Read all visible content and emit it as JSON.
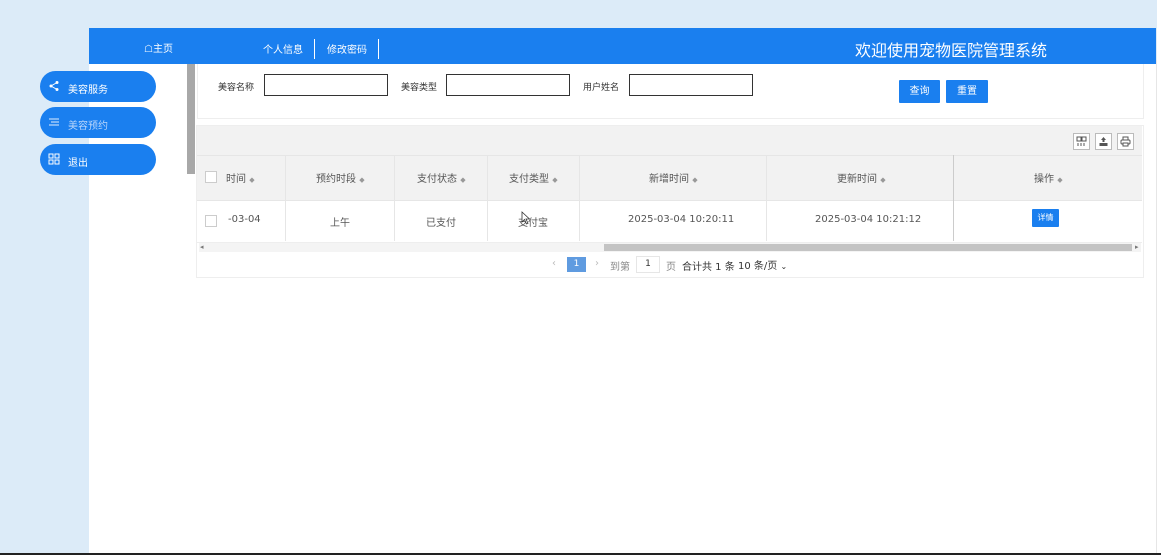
{
  "colors": {
    "primary": "#1a7fef",
    "page_bg": "#dcebf8"
  },
  "header": {
    "home_label": "☖主页",
    "nav": [
      "个人信息",
      "修改密码"
    ],
    "title": "欢迎使用宠物医院管理系统"
  },
  "sidebar": {
    "items": [
      {
        "icon": "share-icon",
        "label": "美容服务"
      },
      {
        "icon": "list-icon",
        "label": "美容预约"
      },
      {
        "icon": "grid-icon",
        "label": "退出"
      }
    ]
  },
  "search": {
    "fields": [
      {
        "label": "美容名称",
        "value": ""
      },
      {
        "label": "美容类型",
        "value": ""
      },
      {
        "label": "用户姓名",
        "value": ""
      }
    ],
    "query_button": "查询",
    "reset_button": "重置"
  },
  "table": {
    "columns": [
      "时间",
      "预约时段",
      "支付状态",
      "支付类型",
      "新增时间",
      "更新时间",
      "操作"
    ],
    "rows": [
      {
        "date": "-03-04",
        "slot": "上午",
        "pay_status": "已支付",
        "pay_type": "支付宝",
        "created": "2025-03-04 10:20:11",
        "updated": "2025-03-04 10:21:12",
        "action": "详情"
      }
    ],
    "toolbar_icons": [
      "columns-icon",
      "export-icon",
      "print-icon"
    ]
  },
  "pagination": {
    "prev": "‹",
    "current_page": "1",
    "next": "›",
    "goto_label": "到第",
    "goto_value": "1",
    "page_unit": "页",
    "total": "合计共 1 条",
    "page_size": "10 条/页"
  }
}
